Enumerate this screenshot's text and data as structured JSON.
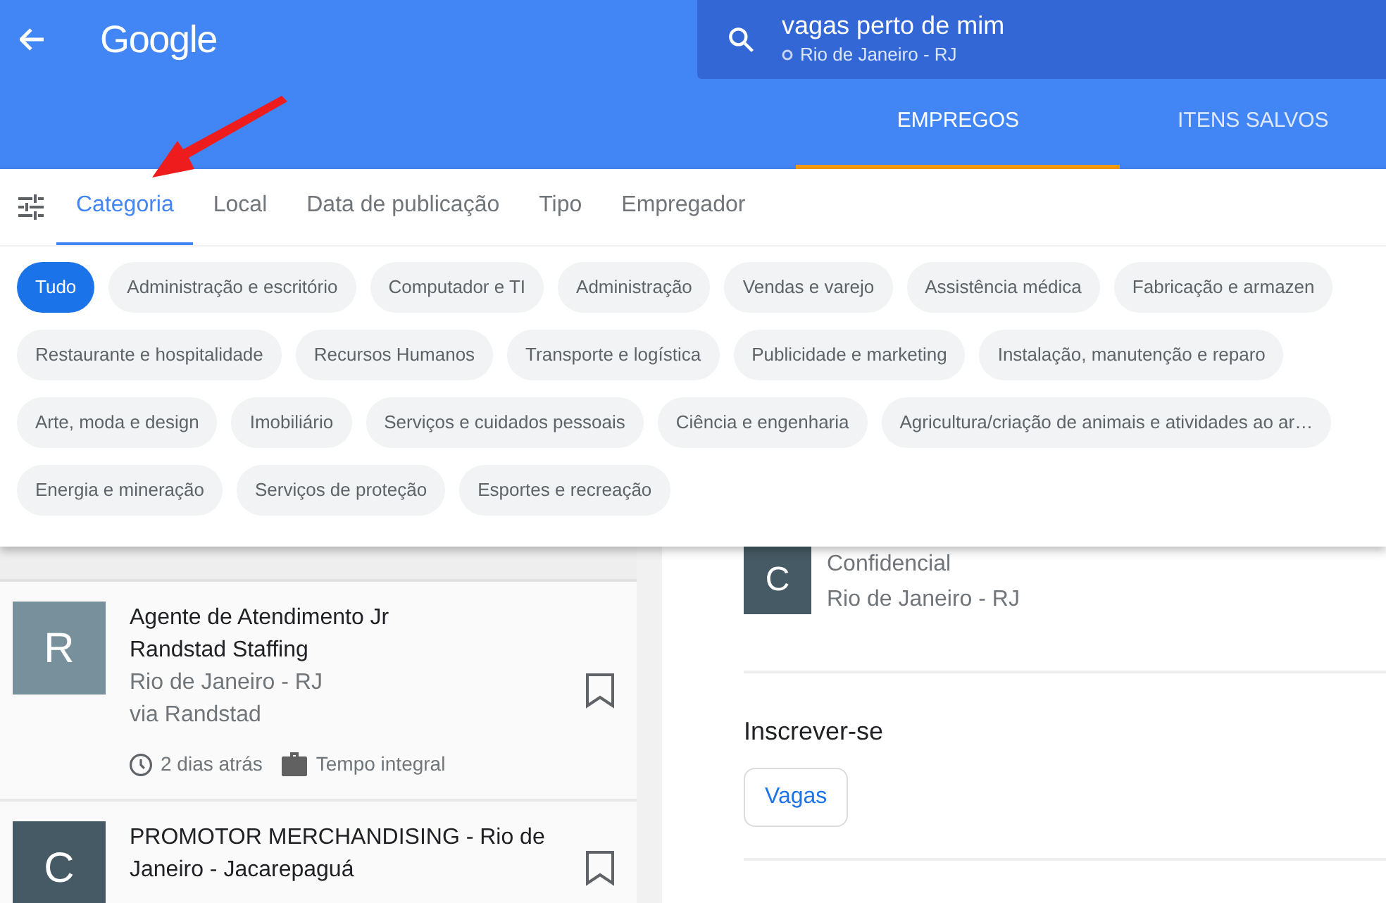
{
  "header": {
    "logo": "Google",
    "search": {
      "query": "vagas perto de mim",
      "location": "Rio de Janeiro - RJ"
    },
    "tabs": [
      {
        "label": "EMPREGOS",
        "selected": true
      },
      {
        "label": "ITENS SALVOS",
        "selected": false
      }
    ]
  },
  "filters": {
    "tabs": [
      {
        "label": "Categoria",
        "selected": true
      },
      {
        "label": "Local",
        "selected": false
      },
      {
        "label": "Data de publicação",
        "selected": false
      },
      {
        "label": "Tipo",
        "selected": false
      },
      {
        "label": "Empregador",
        "selected": false
      }
    ],
    "chip_rows": [
      {
        "chips": [
          {
            "label": "Tudo",
            "selected": true
          },
          {
            "label": "Administração e escritório",
            "selected": false
          },
          {
            "label": "Computador e TI",
            "selected": false
          },
          {
            "label": "Administração",
            "selected": false
          },
          {
            "label": "Vendas e varejo",
            "selected": false
          },
          {
            "label": "Assistência médica",
            "selected": false
          },
          {
            "label": "Fabricação e armazen",
            "selected": false
          }
        ]
      },
      {
        "chips": [
          {
            "label": "Restaurante e hospitalidade",
            "selected": false
          },
          {
            "label": "Recursos Humanos",
            "selected": false
          },
          {
            "label": "Transporte e logística",
            "selected": false
          },
          {
            "label": "Publicidade e marketing",
            "selected": false
          },
          {
            "label": "Instalação, manutenção e reparo",
            "selected": false
          }
        ]
      },
      {
        "chips": [
          {
            "label": "Arte, moda e design",
            "selected": false
          },
          {
            "label": "Imobiliário",
            "selected": false
          },
          {
            "label": "Serviços e cuidados pessoais",
            "selected": false
          },
          {
            "label": "Ciência e engenharia",
            "selected": false
          },
          {
            "label": "Agricultura/criação de animais e atividades ao ar…",
            "selected": false
          }
        ]
      },
      {
        "chips": [
          {
            "label": "Energia e mineração",
            "selected": false
          },
          {
            "label": "Serviços de proteção",
            "selected": false
          },
          {
            "label": "Esportes e recreação",
            "selected": false
          }
        ]
      }
    ]
  },
  "jobs": [
    {
      "kind": "hidden"
    },
    {
      "initial": "R",
      "color": "#78909c",
      "title": "Agente de Atendimento Jr",
      "company": "Randstad Staffing",
      "location": "Rio de Janeiro - RJ",
      "via": "via Randstad",
      "time": "2 dias atrás",
      "type": "Tempo integral"
    },
    {
      "initial": "C",
      "color": "#455a64",
      "title": "PROMOTOR MERCHANDISING - Rio de Janeiro - Jacarepaguá"
    }
  ],
  "detail": {
    "initial": "C",
    "color": "#455a64",
    "company": "Confidencial",
    "location": "Rio de Janeiro - RJ",
    "apply_heading": "Inscrever-se",
    "apply_links": [
      "Vagas"
    ]
  }
}
